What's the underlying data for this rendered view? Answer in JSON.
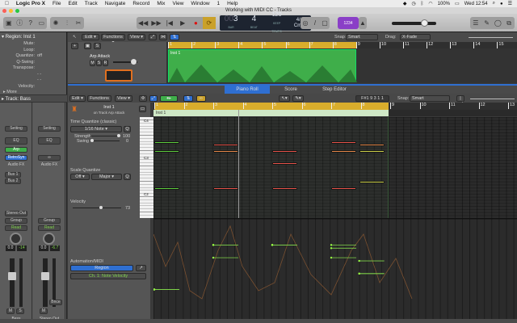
{
  "menubar": {
    "apple": "",
    "app": "Logic Pro X",
    "items": [
      "File",
      "Edit",
      "Track",
      "Navigate",
      "Record",
      "Mix",
      "View",
      "Window",
      "1",
      "Help"
    ],
    "battery": "100%",
    "clock": "Wed 12:54"
  },
  "window": {
    "title": "Working with MIDI CC - Tracks"
  },
  "lcd": {
    "bar": "3",
    "bar_prefix": "00",
    "beat": "4",
    "bar_label": "BAR",
    "beat_label": "BEAT",
    "tempo": "120",
    "tempo_mode": "KEEP",
    "tempo_label": "TEMPO",
    "signature": "4/4",
    "key": "Cmaj"
  },
  "toolbar": {
    "count_in": "1234",
    "master_volume": 0.72
  },
  "inspector": {
    "region_header": "Region: Inst 1",
    "params": [
      {
        "label": "Mute:",
        "value": ""
      },
      {
        "label": "Loop:",
        "value": ""
      },
      {
        "label": "Quantize:",
        "value": "off"
      },
      {
        "label": "Q-Swing:",
        "value": ""
      },
      {
        "label": "Transpose:",
        "value": ""
      },
      {
        "label": "",
        "value": "- -"
      },
      {
        "label": "",
        "value": "- -"
      },
      {
        "label": "Velocity:",
        "value": ""
      }
    ],
    "more": "More",
    "track_header": "Track: Bass"
  },
  "strips": [
    {
      "setting": "Setting",
      "eq": "EQ",
      "midi_fx": "Arp",
      "instrument": "RetroSyn",
      "audio_fx": "Audio FX",
      "sends": [
        "Bus 1",
        "Bus 2"
      ],
      "output": "Stereo Out",
      "group": "Group",
      "automation": "Read",
      "volume": "0.0",
      "peak": "-14",
      "buttons": [
        "M",
        "S"
      ],
      "name": "Bass",
      "fader": 0.72
    },
    {
      "setting": "Setting",
      "eq": "EQ",
      "audio_fx": "Audio FX",
      "group": "Group",
      "automation": "Read",
      "volume": "0.0",
      "peak": "-6.7",
      "bounce": "Bnce",
      "buttons": [
        "M"
      ],
      "name": "Stereo Out",
      "fader": 0.72
    }
  ],
  "tracks_area": {
    "menus": [
      "Edit",
      "Functions",
      "View"
    ],
    "snap_label": "Snap:",
    "snap": "Smart",
    "drag_label": "Drag:",
    "drag": "X-Fade",
    "ruler": [
      "1",
      "2",
      "3",
      "4",
      "5",
      "6",
      "7",
      "8",
      "9",
      "10",
      "11",
      "12",
      "13",
      "14",
      "15"
    ],
    "track": {
      "name": "Arp Attack",
      "buttons": [
        "M",
        "S",
        "R"
      ]
    },
    "region": "Inst 1"
  },
  "editor": {
    "tabs": [
      "Piano Roll",
      "Score",
      "Step Editor"
    ],
    "active_tab": "Piano Roll",
    "menus": [
      "Edit",
      "Functions",
      "View"
    ],
    "position": "F#1  9 3 1 1",
    "snap_label": "Snap:",
    "snap": "Smart",
    "ruler": [
      "1",
      "2",
      "3",
      "4",
      "5",
      "6",
      "7",
      "8",
      "9",
      "10",
      "11",
      "12",
      "13"
    ],
    "region": "Inst 1",
    "key_labels": [
      "C4",
      "C3",
      "C2"
    ],
    "inst_name": "Inst 1",
    "inst_sub": "on Track Arp Attack",
    "time_quantize": {
      "title": "Time Quantize (classic)",
      "value": "1/16 Note",
      "strength_label": "Strength",
      "strength": "100",
      "swing_label": "Swing",
      "swing": "0"
    },
    "scale_quantize": {
      "title": "Scale Quantize",
      "root": "Off",
      "scale": "Major"
    },
    "velocity": {
      "title": "Velocity",
      "value": "73"
    },
    "automation": {
      "title": "Automation/MIDI",
      "mode": "Region",
      "param": "Ch. 1: Note Velocity"
    }
  },
  "notes": [
    {
      "bar": 1,
      "len": 0.85,
      "pitch": 53,
      "vel": 40
    },
    {
      "bar": 1,
      "len": 0.85,
      "pitch": 50,
      "vel": 40
    },
    {
      "bar": 1,
      "len": 0.85,
      "pitch": 38,
      "vel": 40
    },
    {
      "bar": 3,
      "len": 0.85,
      "pitch": 52,
      "vel": 110
    },
    {
      "bar": 3,
      "len": 0.85,
      "pitch": 50,
      "vel": 90
    },
    {
      "bar": 3,
      "len": 0.85,
      "pitch": 38,
      "vel": 110
    },
    {
      "bar": 5,
      "len": 0.85,
      "pitch": 50,
      "vel": 110
    },
    {
      "bar": 5,
      "len": 0.85,
      "pitch": 46,
      "vel": 110
    },
    {
      "bar": 5,
      "len": 0.85,
      "pitch": 38,
      "vel": 110
    },
    {
      "bar": 7,
      "len": 0.85,
      "pitch": 53,
      "vel": 105
    },
    {
      "bar": 7,
      "len": 0.85,
      "pitch": 50,
      "vel": 90
    },
    {
      "bar": 7,
      "len": 0.85,
      "pitch": 38,
      "vel": 110
    },
    {
      "bar": 7.95,
      "len": 0.85,
      "pitch": 52,
      "vel": 85
    },
    {
      "bar": 7.95,
      "len": 0.85,
      "pitch": 50,
      "vel": 65
    },
    {
      "bar": 7.95,
      "len": 0.85,
      "pitch": 40,
      "vel": 65
    }
  ],
  "colors": {
    "accent": "#2f6fd1",
    "yellow": "#d9ad2c",
    "region": "#3fae4a",
    "count_in": "#8a3fc7"
  }
}
